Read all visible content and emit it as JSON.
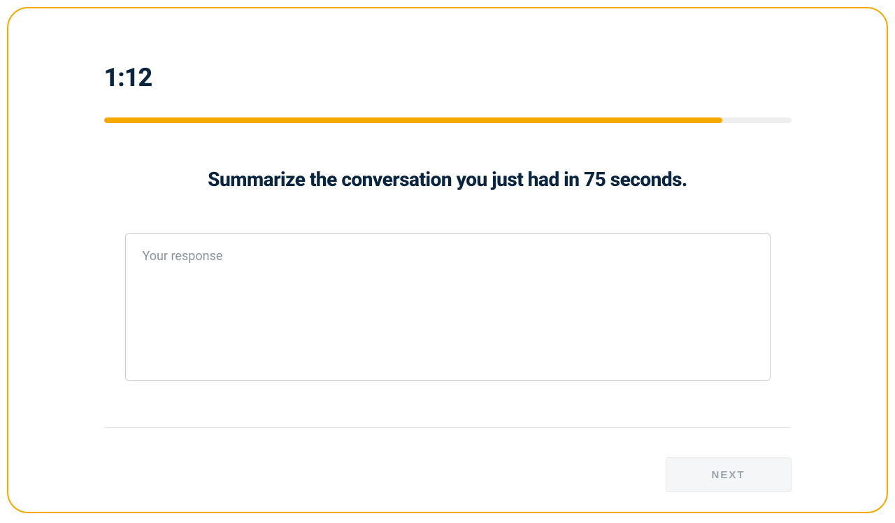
{
  "timer": {
    "display": "1:12"
  },
  "progress": {
    "percent": 90
  },
  "prompt": {
    "text": "Summarize the conversation you just had in 75 seconds."
  },
  "response": {
    "placeholder": "Your response",
    "value": ""
  },
  "footer": {
    "next_label": "NEXT"
  }
}
